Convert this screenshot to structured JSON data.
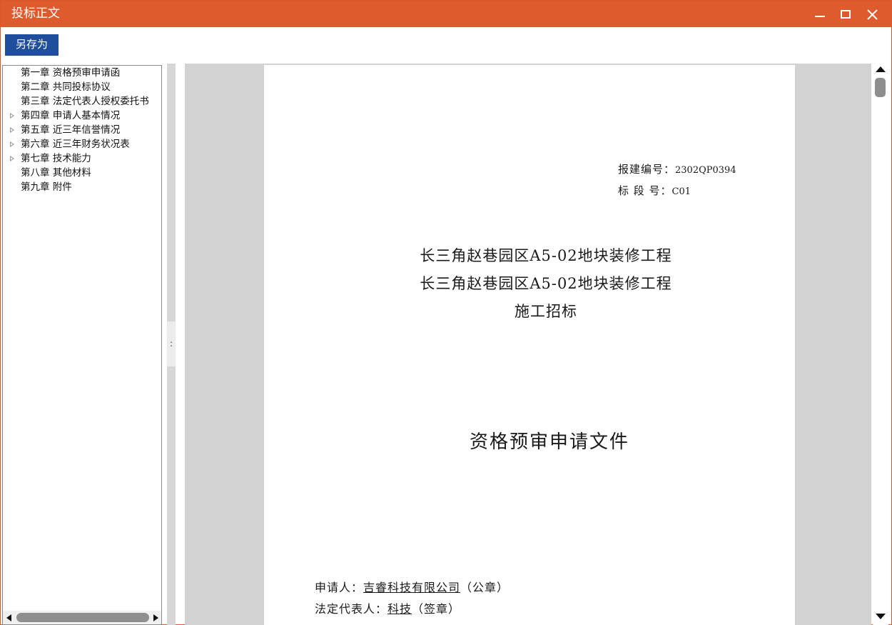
{
  "window": {
    "title": "投标正文",
    "title_color": "#dd5b2c",
    "controls": [
      "minimize-icon",
      "maximize-icon",
      "close-icon"
    ]
  },
  "toolbar": {
    "save_as_label": "另存为",
    "button_color": "#1f4e9c"
  },
  "tree": {
    "items": [
      {
        "label": "第一章 资格预审申请函",
        "expandable": false
      },
      {
        "label": "第二章 共同投标协议",
        "expandable": false
      },
      {
        "label": "第三章 法定代表人授权委托书",
        "expandable": false
      },
      {
        "label": "第四章 申请人基本情况",
        "expandable": true
      },
      {
        "label": "第五章 近三年信誉情况",
        "expandable": true
      },
      {
        "label": "第六章 近三年财务状况表",
        "expandable": true
      },
      {
        "label": "第七章 技术能力",
        "expandable": true
      },
      {
        "label": "第八章 其他材料",
        "expandable": false
      },
      {
        "label": "第九章 附件",
        "expandable": false
      }
    ]
  },
  "splitter": {
    "grip_label": ":"
  },
  "document": {
    "project_no_label": "报建编号：",
    "project_no_value": "2302QP0394",
    "section_no_label": "标 段 号：",
    "section_no_value": "C01",
    "title_line1": "长三角赵巷园区A5-02地块装修工程",
    "title_line2": "长三角赵巷园区A5-02地块装修工程",
    "title_line3": "施工招标",
    "doc_title": "资格预审申请文件",
    "applicant_label": "申请人：",
    "applicant_value": "吉睿科技有限公司",
    "applicant_suffix": "（公章）",
    "rep_label": "法定代表人：",
    "rep_value": "科技",
    "rep_suffix": "（签章）"
  }
}
